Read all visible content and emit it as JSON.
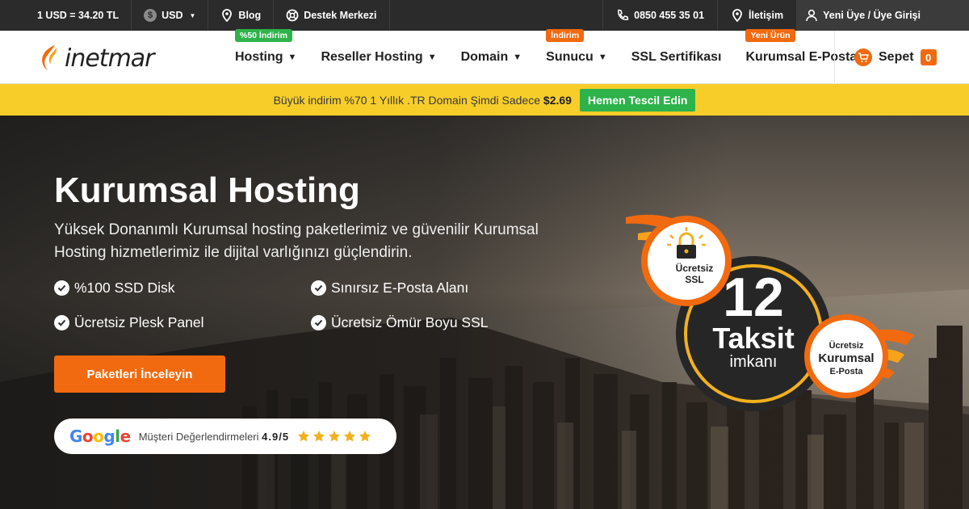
{
  "topbar": {
    "rate": "1 USD = 34.20 TL",
    "currency": "USD",
    "blog": "Blog",
    "support": "Destek Merkezi",
    "phone": "0850 455 35 01",
    "contact": "İletişim",
    "login": "Yeni Üye / Üye Girişi"
  },
  "header": {
    "logo_text": "inetmar",
    "nav": [
      {
        "label": "Hosting",
        "badge": "%50 İndirim"
      },
      {
        "label": "Reseller Hosting",
        "badge": ""
      },
      {
        "label": "Domain",
        "badge": ""
      },
      {
        "label": "Sunucu",
        "badge": "İndirim"
      },
      {
        "label": "SSL Sertifikası",
        "badge": ""
      },
      {
        "label": "Kurumsal E-Posta",
        "badge": "Yeni Ürün"
      }
    ],
    "cart_label": "Sepet",
    "cart_count": "0"
  },
  "promo": {
    "text": "Büyük indirim %70 1 Yıllık .TR Domain Şimdi Sadece",
    "price": "$2.69",
    "button": "Hemen Tescil Edin"
  },
  "hero": {
    "title": "Kurumsal Hosting",
    "description": "Yüksek Donanımlı Kurumsal hosting paketlerimiz ve güvenilir Kurumsal Hosting hizmetlerimiz ile dijital varlığınızı güçlendirin.",
    "features": [
      "%100 SSD Disk",
      "Sınırsız E-Posta Alanı",
      "Ücretsiz Plesk Panel",
      "Ücretsiz Ömür Boyu SSL"
    ],
    "cta": "Paketleri İnceleyin",
    "review_brand": "Google",
    "review_label": "Müşteri Değerlendirmeleri",
    "review_score": "4.9/5",
    "review_stars": 5
  },
  "badge": {
    "ssl_line1": "Ücretsiz",
    "ssl_line2": "SSL",
    "number": "12",
    "taksit": "Taksit",
    "imkani": "imkanı",
    "mail_line1": "Ücretsiz",
    "mail_line2": "Kurumsal",
    "mail_line3": "E-Posta"
  },
  "colors": {
    "accent": "#f26a0f",
    "green": "#2db34a",
    "promo": "#f7cd2a",
    "topbar": "#2b2b2b",
    "badge_gold": "#f2b01e"
  },
  "icons": [
    "dollar-icon",
    "location-pin-icon",
    "lifebuoy-icon",
    "phone-icon",
    "user-icon",
    "cart-icon",
    "check-circle-icon",
    "star-icon",
    "padlock-icon"
  ]
}
